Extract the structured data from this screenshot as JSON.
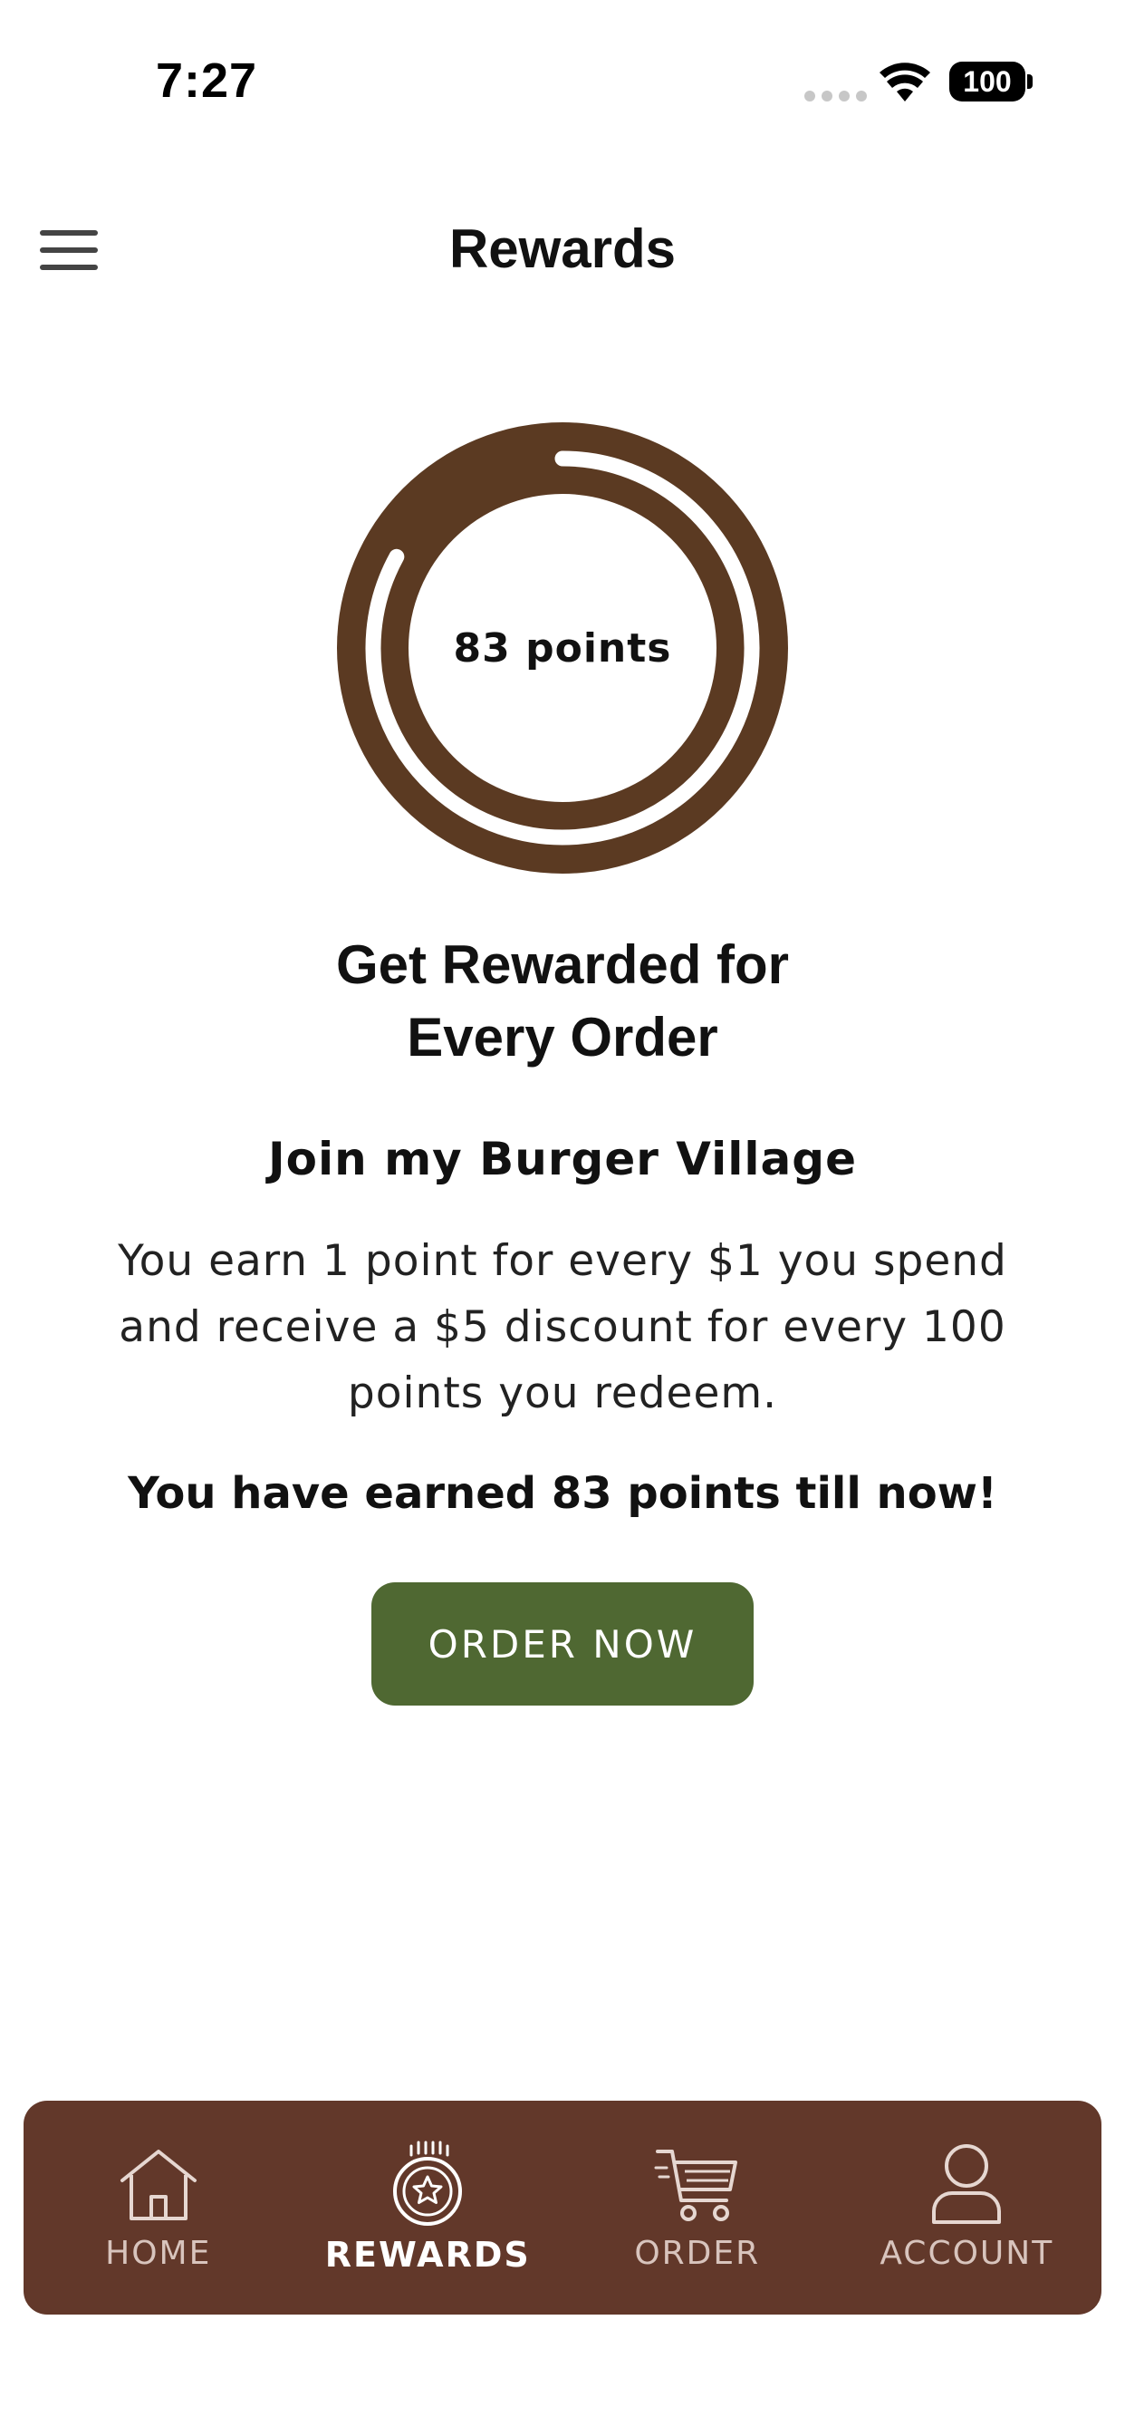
{
  "status_bar": {
    "time": "7:27",
    "battery": "100"
  },
  "header": {
    "title": "Rewards",
    "menu_icon": "hamburger-menu-icon"
  },
  "rewards": {
    "points_label": "83 points",
    "points": 83,
    "points_goal": 100,
    "progress_fraction": 0.83,
    "ring_color": "#5b3a22",
    "headline_line1": "Get Rewarded for",
    "headline_line2": "Every Order",
    "subheading": "Join my Burger Village",
    "description": "You earn 1 point for every $1 you spend and receive a $5 discount for every 100 points you redeem.",
    "earned_message": "You have earned 83 points till now!"
  },
  "cta": {
    "label": "ORDER NOW",
    "color": "#4f6832"
  },
  "bottom_nav": {
    "background": "#62382a",
    "items": [
      {
        "label": "HOME",
        "icon": "home-icon",
        "active": false
      },
      {
        "label": "REWARDS",
        "icon": "rewards-badge-icon",
        "active": true
      },
      {
        "label": "ORDER",
        "icon": "cart-icon",
        "active": false
      },
      {
        "label": "ACCOUNT",
        "icon": "user-icon",
        "active": false
      }
    ]
  }
}
